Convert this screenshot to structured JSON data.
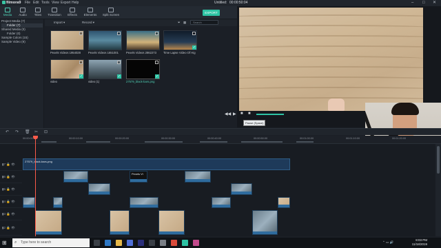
{
  "app": {
    "name": "filmora9",
    "project_title": "Untitled:",
    "project_time": "00:00:50:04",
    "menu": [
      "File",
      "Edit",
      "Tools",
      "View",
      "Export",
      "Help"
    ],
    "window_controls": [
      "–",
      "□",
      "✕"
    ]
  },
  "toolbar": {
    "tabs": [
      "Media",
      "Audio",
      "Titles",
      "Transition",
      "Effects",
      "Elements",
      "Split Screen"
    ],
    "active_tab": "Media",
    "export_label": "EXPORT"
  },
  "sidebar": {
    "items": [
      {
        "label": "Project Media (7)",
        "selected": false
      },
      {
        "label": "Folder (7)",
        "selected": true
      },
      {
        "label": "Shared Media (0)",
        "selected": false
      },
      {
        "label": "Folder (0)",
        "selected": false
      },
      {
        "label": "Sample Colors (15)",
        "selected": false
      },
      {
        "label": "Sample Video (9)",
        "selected": false
      }
    ]
  },
  "media_bar": {
    "import_label": "Import",
    "record_label": "Record",
    "search_placeholder": "Search"
  },
  "media": {
    "items": [
      {
        "label": "Pexels Videos 1954028",
        "style": "sand",
        "checked": false,
        "highlight": false
      },
      {
        "label": "Pexels Videos 1651001",
        "style": "sea",
        "checked": false,
        "highlight": false
      },
      {
        "label": "Pexels Videos 2862273",
        "style": "sunset",
        "checked": false,
        "highlight": false
      },
      {
        "label": "Time Lapse Video Of Hig",
        "style": "city",
        "checked": true,
        "highlight": false
      },
      {
        "label": "video",
        "style": "hand",
        "checked": true,
        "highlight": false
      },
      {
        "label": "video (1)",
        "style": "street",
        "checked": true,
        "highlight": false
      },
      {
        "label": "27579_black-bars.png",
        "style": "dark",
        "checked": true,
        "highlight": true
      }
    ]
  },
  "preview": {
    "tooltip": "Pause (Space)",
    "controls": [
      "◀◀",
      "▶",
      "■",
      "■"
    ]
  },
  "timeline": {
    "tools": [
      "↶",
      "↷",
      "🗑",
      "✂",
      "⊡"
    ],
    "ruler": [
      "00:00:00:00",
      "00:00:10:00",
      "00:00:20:00",
      "00:00:30:00",
      "00:00:40:00",
      "00:00:50:00",
      "00:01:00:00",
      "00:01:10:00",
      "00:01:20:00",
      "00:01:30:00",
      "00:01:40:00"
    ],
    "track_labels": [
      "▮7",
      "▮6",
      "▮5",
      "▮4",
      "▮3",
      "▮2",
      "▮1"
    ],
    "clip_labels": {
      "black_bars": "27579_black-bars-png",
      "pexels": "Pexels Vi"
    }
  },
  "taskbar": {
    "search_placeholder": "Type here to search",
    "time": "8:03 PM",
    "date": "11/18/2019"
  },
  "colors": {
    "accent": "#2ec3a4",
    "playhead": "#ff5b4a",
    "clip_bar": "#2f6c9e"
  }
}
